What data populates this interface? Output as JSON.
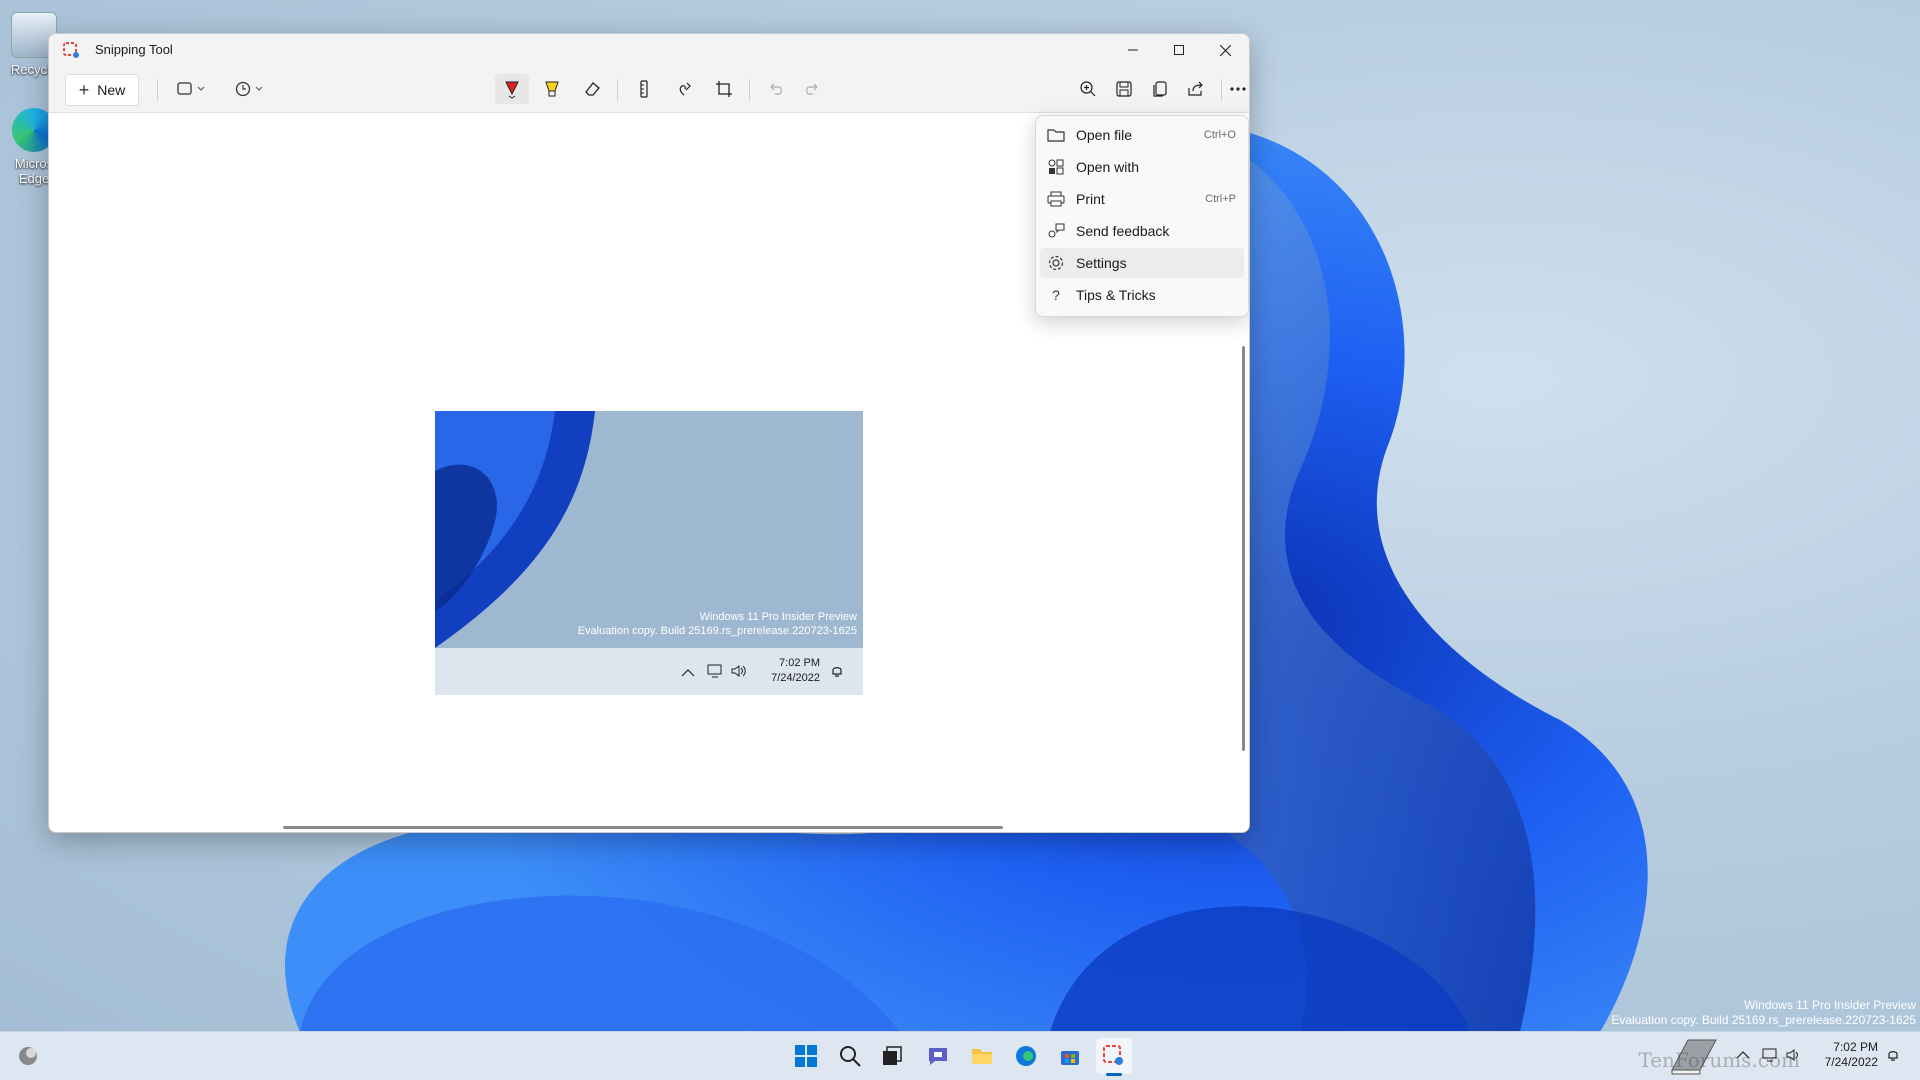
{
  "window": {
    "title": "Snipping Tool",
    "new_label": "New"
  },
  "toolbar_icons": [
    "snip-mode-icon",
    "delay-icon",
    "ballpoint-pen-icon",
    "highlighter-icon",
    "eraser-icon",
    "ruler-icon",
    "touch-writing-icon",
    "crop-icon",
    "undo-icon",
    "redo-icon",
    "zoom-icon",
    "save-icon",
    "copy-icon",
    "share-icon",
    "more-icon"
  ],
  "menu": {
    "items": [
      {
        "label": "Open file",
        "shortcut": "Ctrl+O",
        "icon": "folder-icon"
      },
      {
        "label": "Open with",
        "shortcut": "",
        "icon": "open-with-icon"
      },
      {
        "label": "Print",
        "shortcut": "Ctrl+P",
        "icon": "printer-icon"
      },
      {
        "label": "Send feedback",
        "shortcut": "",
        "icon": "feedback-icon"
      },
      {
        "label": "Settings",
        "shortcut": "",
        "icon": "gear-icon"
      },
      {
        "label": "Tips & Tricks",
        "shortcut": "",
        "icon": "question-icon"
      }
    ]
  },
  "preview": {
    "watermark_line1": "Windows 11 Pro Insider Preview",
    "watermark_line2": "Evaluation copy. Build 25169.rs_prerelease.220723-1625",
    "time": "7:02 PM",
    "date": "7/24/2022"
  },
  "desktop": {
    "icon1_label": "Recycle",
    "icon2_label": "Micros Edge",
    "watermark_line1": "Windows 11 Pro Insider Preview",
    "watermark_line2": "Evaluation copy. Build 25169.rs_prerelease.220723-1625"
  },
  "taskbar": {
    "time": "7:02 PM",
    "date": "7/24/2022",
    "brand": "TenForums.com"
  },
  "colors": {
    "accent": "#0067c0",
    "wallpaper_blue": "#1a4fd8"
  }
}
